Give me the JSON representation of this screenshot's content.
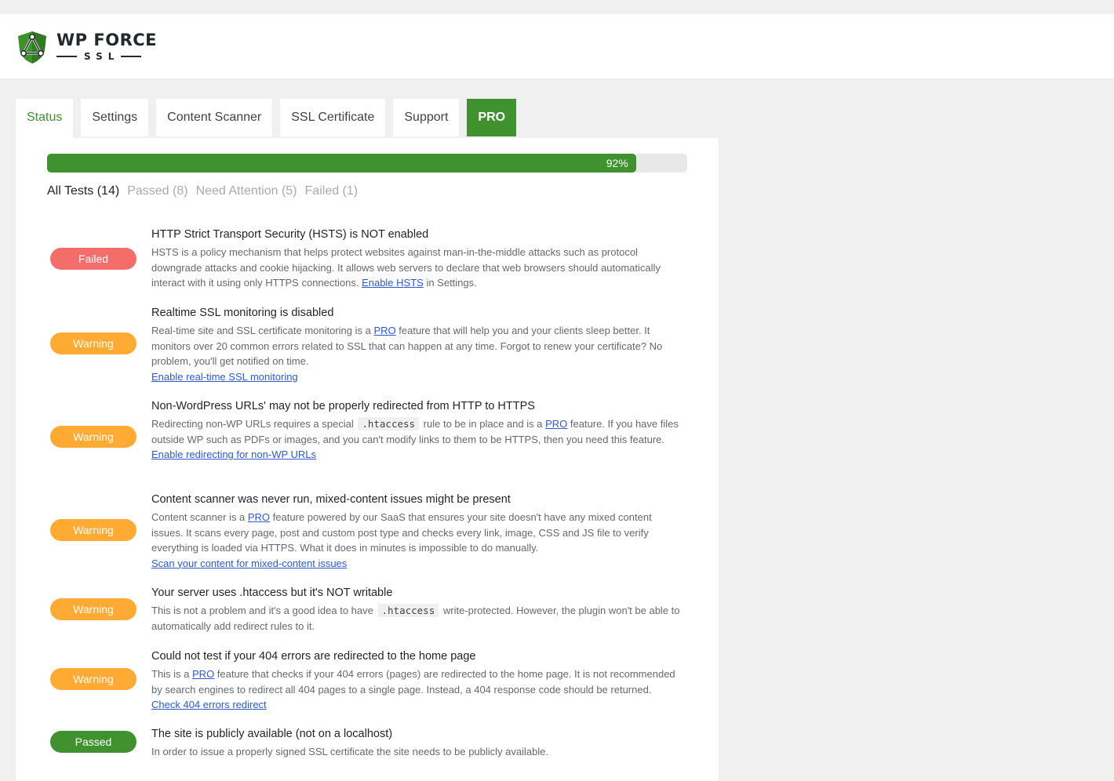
{
  "app": {
    "logo_main": "WP FORCE",
    "logo_sub": "SSL",
    "brand_green": "#40922e"
  },
  "tabs": [
    {
      "label": "Status",
      "active": true
    },
    {
      "label": "Settings"
    },
    {
      "label": "Content Scanner"
    },
    {
      "label": "SSL Certificate"
    },
    {
      "label": "Support"
    },
    {
      "label": "PRO"
    }
  ],
  "progress": {
    "value": 92,
    "label": "92%"
  },
  "filters": [
    {
      "label": "All Tests (14)",
      "active": true
    },
    {
      "label": "Passed (8)"
    },
    {
      "label": "Need Attention (5)"
    },
    {
      "label": "Failed (1)"
    }
  ],
  "tests": [
    {
      "status": "Failed",
      "title": "HTTP Strict Transport Security (HSTS) is NOT enabled",
      "desc_a": "HSTS is a policy mechanism that helps protect websites against man-in-the-middle attacks such as protocol downgrade attacks and cookie hijacking. It allows web servers to declare that web browsers should automatically interact with it using only HTTPS connections. ",
      "link": "Enable HSTS",
      "desc_b": " in Settings."
    },
    {
      "status": "Warning",
      "title": "Realtime SSL monitoring is disabled",
      "desc_a": "Real-time site and SSL certificate monitoring is a ",
      "pro": "PRO",
      "desc_b": " feature that will help you and your clients sleep better. It monitors over 20 common errors related to SSL that can happen at any time. Forgot to renew your certificate? No problem, you'll get notified on time.",
      "link": "Enable real-time SSL monitoring"
    },
    {
      "status": "Warning",
      "title": "Non-WordPress URLs' may not be properly redirected from HTTP to HTTPS",
      "desc_a": "Redirecting non-WP URLs requires a special ",
      "code": ".htaccess",
      "desc_b": " rule to be in place and is a ",
      "pro": "PRO",
      "desc_c": " feature. If you have files outside WP such as PDFs or images, and you can't modify links to them to be HTTPS, then you need this feature.",
      "link": "Enable redirecting for non-WP URLs"
    },
    {
      "status": "Warning",
      "title": "Content scanner was never run, mixed-content issues might be present",
      "desc_a": "Content scanner is a ",
      "pro": "PRO",
      "desc_b": " feature powered by our SaaS that ensures your site doesn't have any mixed content issues. It scans every page, post and custom post type and checks every link, image, CSS and JS file to verify everything is loaded via HTTPS. What it does in minutes is impossible to do manually.",
      "link": "Scan your content for mixed-content issues"
    },
    {
      "status": "Warning",
      "title": "Your server uses .htaccess but it's NOT writable",
      "desc_a": "This is not a problem and it's a good idea to have ",
      "code": ".htaccess",
      "desc_b": " write-protected. However, the plugin won't be able to automatically add redirect rules to it."
    },
    {
      "status": "Warning",
      "title": "Could not test if your 404 errors are redirected to the home page",
      "desc_a": "This is a ",
      "pro": "PRO",
      "desc_b": " feature that checks if your 404 errors (pages) are redirected to the home page. It is not recommended by search engines to redirect all 404 pages to a single page. Instead, a 404 response code should be returned.",
      "link": "Check 404 errors redirect"
    },
    {
      "status": "Passed",
      "title": "The site is publicly available (not on a localhost)",
      "desc_a": "In order to issue a properly signed SSL certificate the site needs to be publicly available."
    }
  ]
}
